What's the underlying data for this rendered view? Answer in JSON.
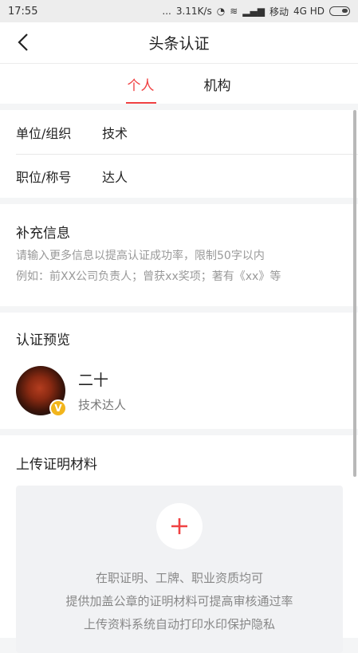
{
  "status_bar": {
    "time": "17:55",
    "dots": "...",
    "speed": "3.11K/s",
    "carrier": "移动",
    "network": "4G HD"
  },
  "navbar": {
    "title": "头条认证"
  },
  "tabs": [
    {
      "label": "个人",
      "active": true
    },
    {
      "label": "机构",
      "active": false
    }
  ],
  "form": {
    "org_label": "单位/组织",
    "org_value": "技术",
    "title_label": "职位/称号",
    "title_value": "达人"
  },
  "extra_info": {
    "title": "补充信息",
    "placeholder_line1": "请输入更多信息以提高认证成功率，限制50字以内",
    "placeholder_line2": "例如：前XX公司负责人；曾获xx奖项；著有《xx》等"
  },
  "preview": {
    "title": "认证预览",
    "name": "二十",
    "subtitle": "技术达人",
    "badge": "V"
  },
  "upload": {
    "title": "上传证明材料",
    "line1": "在职证明、工牌、职业资质均可",
    "line2": "提供加盖公章的证明材料可提高审核通过率",
    "line3": "上传资料系统自动打印水印保护隐私"
  },
  "colors": {
    "accent": "#f04142",
    "badge": "#f2b51c"
  },
  "icons": [
    "back-arrow-icon",
    "plus-icon",
    "verified-badge-icon"
  ]
}
